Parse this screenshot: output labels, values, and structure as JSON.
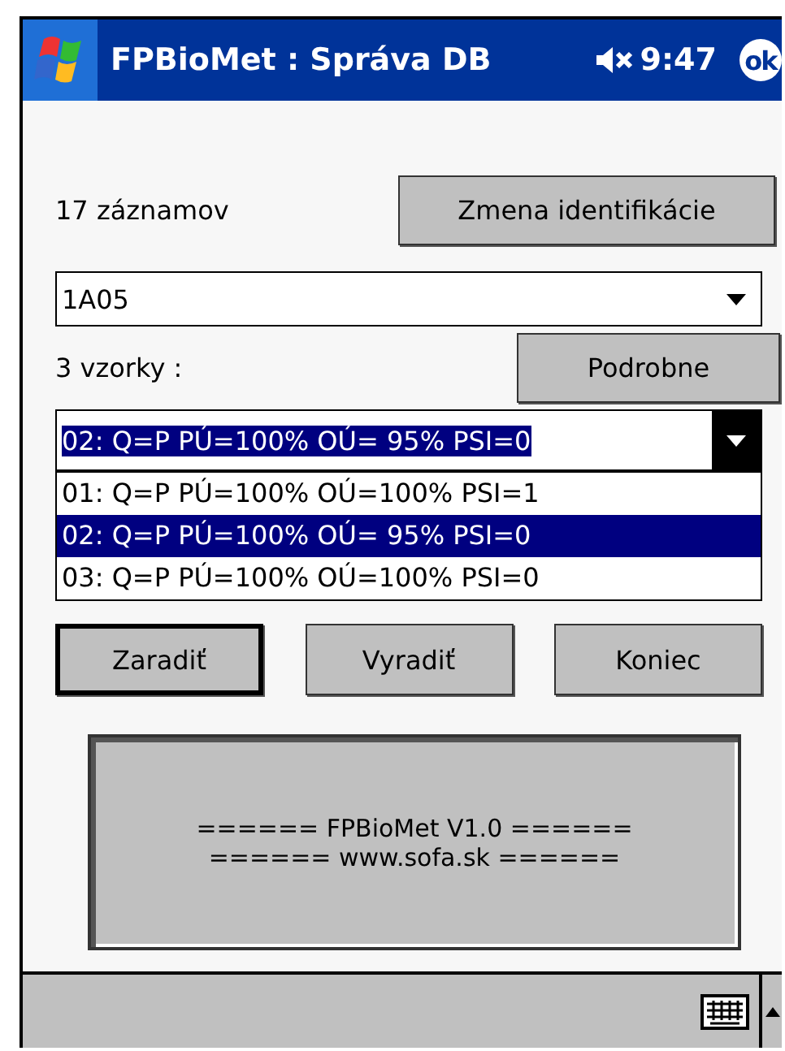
{
  "title_bar": {
    "title": "FPBioMet : Správa DB",
    "muted": true,
    "time": "9:47",
    "ok": "ok"
  },
  "record_count": "17 záznamov",
  "change_id_button": "Zmena identifikácie",
  "id_combo": {
    "value": "1A05"
  },
  "sample_count": "3 vzorky :",
  "details_button": "Podrobne",
  "sample_combo": {
    "value": "02: Q=P PÚ=100% OÚ= 95% PSI=0",
    "expanded": true,
    "options": [
      {
        "label": "01: Q=P PÚ=100% OÚ=100% PSI=1",
        "selected": false
      },
      {
        "label": "02: Q=P PÚ=100% OÚ= 95% PSI=0",
        "selected": true
      },
      {
        "label": "03: Q=P PÚ=100% OÚ=100% PSI=0",
        "selected": false
      }
    ]
  },
  "buttons": [
    {
      "label": "Zaradiť",
      "default": true
    },
    {
      "label": "Vyradiť",
      "default": false
    },
    {
      "label": "Koniec",
      "default": false
    }
  ],
  "info_lines": [
    "====== FPBioMet V1.0 ======",
    "====== www.sofa.sk ======"
  ]
}
